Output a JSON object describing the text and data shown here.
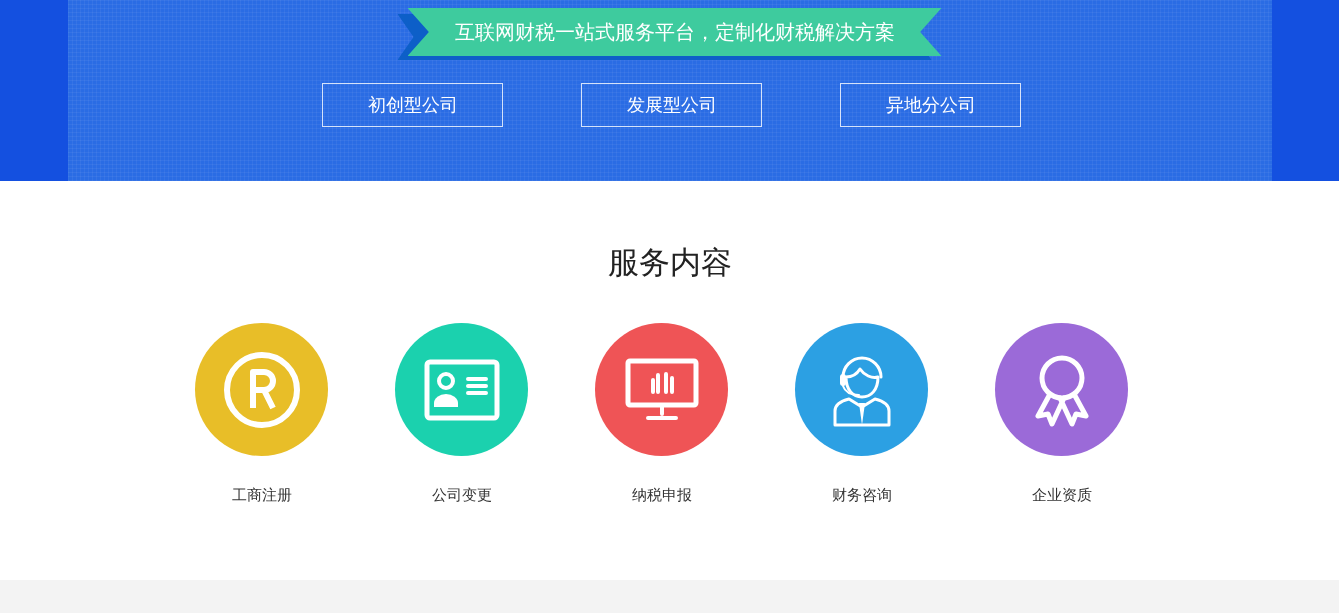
{
  "banner": {
    "slogan": "互联网财税一站式服务平台，定制化财税解决方案",
    "buttons": [
      "初创型公司",
      "发展型公司",
      "异地分公司"
    ]
  },
  "services": {
    "title": "服务内容",
    "items": [
      {
        "label": "工商注册",
        "color": "#e8be28"
      },
      {
        "label": "公司变更",
        "color": "#1bd1ae"
      },
      {
        "label": "纳税申报",
        "color": "#ef5456"
      },
      {
        "label": "财务咨询",
        "color": "#2ca0e3"
      },
      {
        "label": "企业资质",
        "color": "#9b6ad8"
      }
    ]
  }
}
